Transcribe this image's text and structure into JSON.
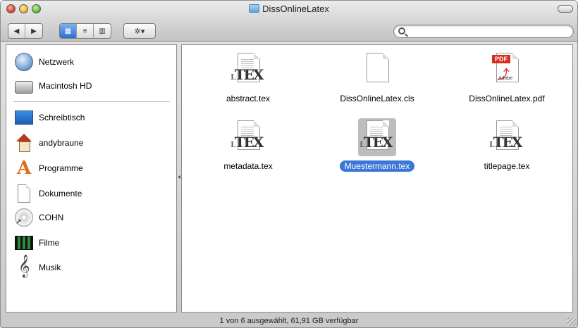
{
  "window": {
    "title": "DissOnlineLatex"
  },
  "toolbar": {
    "back_glyph": "◀",
    "forward_glyph": "▶",
    "view_icon_glyph": "▦",
    "view_list_glyph": "≡",
    "view_column_glyph": "▥",
    "action_glyph": "✲▾"
  },
  "search": {
    "value": "",
    "placeholder": ""
  },
  "sidebar": {
    "items": [
      {
        "label": "Netzwerk",
        "icon": "network-icon"
      },
      {
        "label": "Macintosh HD",
        "icon": "hard-drive-icon"
      },
      {
        "label": "Schreibtisch",
        "icon": "desktop-icon"
      },
      {
        "label": "andybraune",
        "icon": "home-icon"
      },
      {
        "label": "Programme",
        "icon": "applications-icon"
      },
      {
        "label": "Dokumente",
        "icon": "documents-icon"
      },
      {
        "label": "COHN",
        "icon": "disc-icon"
      },
      {
        "label": "Filme",
        "icon": "movies-icon"
      },
      {
        "label": "Musik",
        "icon": "music-icon"
      }
    ]
  },
  "files": [
    {
      "name": "abstract.tex",
      "icon": "tex-file-icon",
      "selected": false
    },
    {
      "name": "DissOnlineLatex.cls",
      "icon": "blank-document-icon",
      "selected": false
    },
    {
      "name": "DissOnlineLatex.pdf",
      "icon": "pdf-file-icon",
      "selected": false
    },
    {
      "name": "metadata.tex",
      "icon": "tex-file-icon",
      "selected": false
    },
    {
      "name": "Muestermann.tex",
      "icon": "tex-file-icon",
      "selected": true
    },
    {
      "name": "titlepage.tex",
      "icon": "tex-file-icon",
      "selected": false
    }
  ],
  "icon_text": {
    "tex": "TEX",
    "tex_prefix": "L",
    "pdf": "PDF",
    "adobe": "Adobe"
  },
  "status": {
    "text": "1 von 6 ausgewählt, 61,91 GB verfügbar"
  },
  "colors": {
    "selection": "#3a77d6",
    "active_view": "#2c6fd0",
    "pdf_red": "#d62a22"
  }
}
